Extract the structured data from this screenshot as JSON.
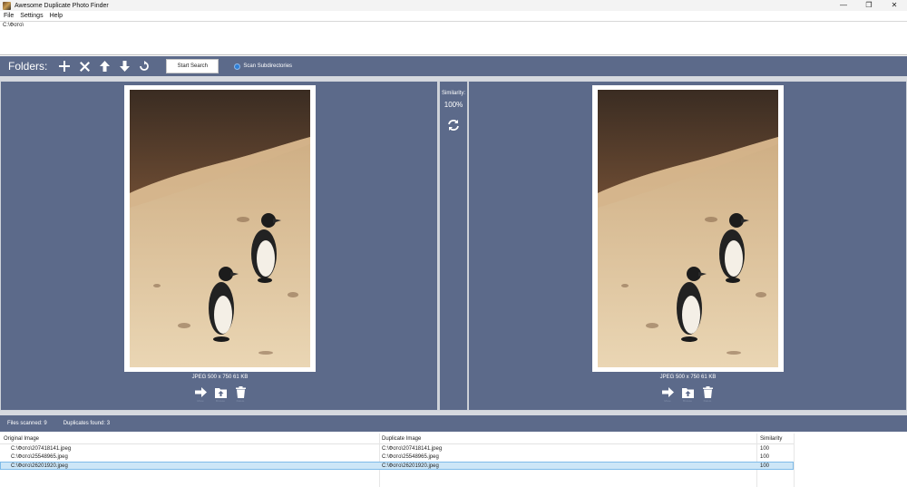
{
  "window": {
    "title": "Awesome Duplicate Photo Finder",
    "controls": [
      "—",
      "❐",
      "✕"
    ]
  },
  "menu": [
    "File",
    "Settings",
    "Help"
  ],
  "folders": {
    "entries": [
      "C:\\Фото\\"
    ],
    "label": "Folders:",
    "start_search": "Start Search",
    "scan_subdirectories": "Scan Subdirectories",
    "scan_subdirectories_checked": true
  },
  "comparison": {
    "similarity_label": "Similarity:",
    "similarity_value": "100%",
    "left": {
      "info": "JPEG  500 x 750  61 KB",
      "actions": [
        "Move",
        "Browse",
        "Delete"
      ]
    },
    "right": {
      "info": "JPEG  500 x 750  61 KB",
      "actions": [
        "Move",
        "Browse",
        "Delete"
      ]
    }
  },
  "status": {
    "files_scanned": "Files scanned: 9",
    "duplicates_found": "Duplicates found: 3"
  },
  "results": {
    "columns": [
      "Original Image",
      "Duplicate Image",
      "Similarity"
    ],
    "rows": [
      [
        "C:\\Фото\\207418141.jpeg",
        "C:\\Фото\\207418141.jpeg",
        "100"
      ],
      [
        "C:\\Фото\\25548965.jpeg",
        "C:\\Фото\\25548965.jpeg",
        "100"
      ],
      [
        "C:\\Фото\\26201920.jpeg",
        "C:\\Фото\\26201920.jpeg",
        "100"
      ]
    ],
    "selected_row": 2
  },
  "colors": {
    "panel": "#5c6a8a",
    "accent": "#2f7fd6",
    "selection": "#cde6f7"
  }
}
